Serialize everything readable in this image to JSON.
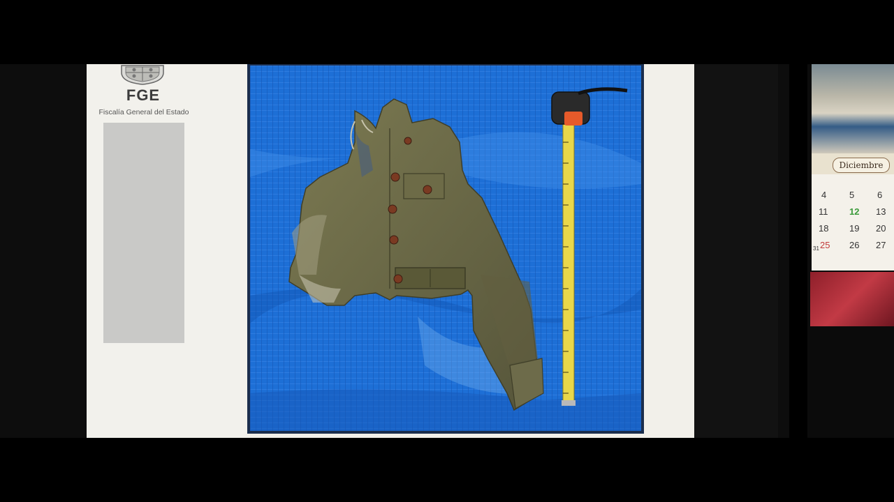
{
  "header": {
    "org_abbr": "FGE",
    "org_name": "Fiscalía General del Estado"
  },
  "calendar": {
    "month": "Diciembre",
    "days": [
      "4",
      "5",
      "6",
      "11",
      "12",
      "13",
      "18",
      "19",
      "20",
      "25",
      "26",
      "27",
      "31"
    ]
  },
  "colors": {
    "tarp_blue": "#1d6fd6",
    "jacket_olive": "#6b6a45",
    "tape_yellow": "#e9d74a",
    "redaction_gray": "#c9c9c7"
  }
}
